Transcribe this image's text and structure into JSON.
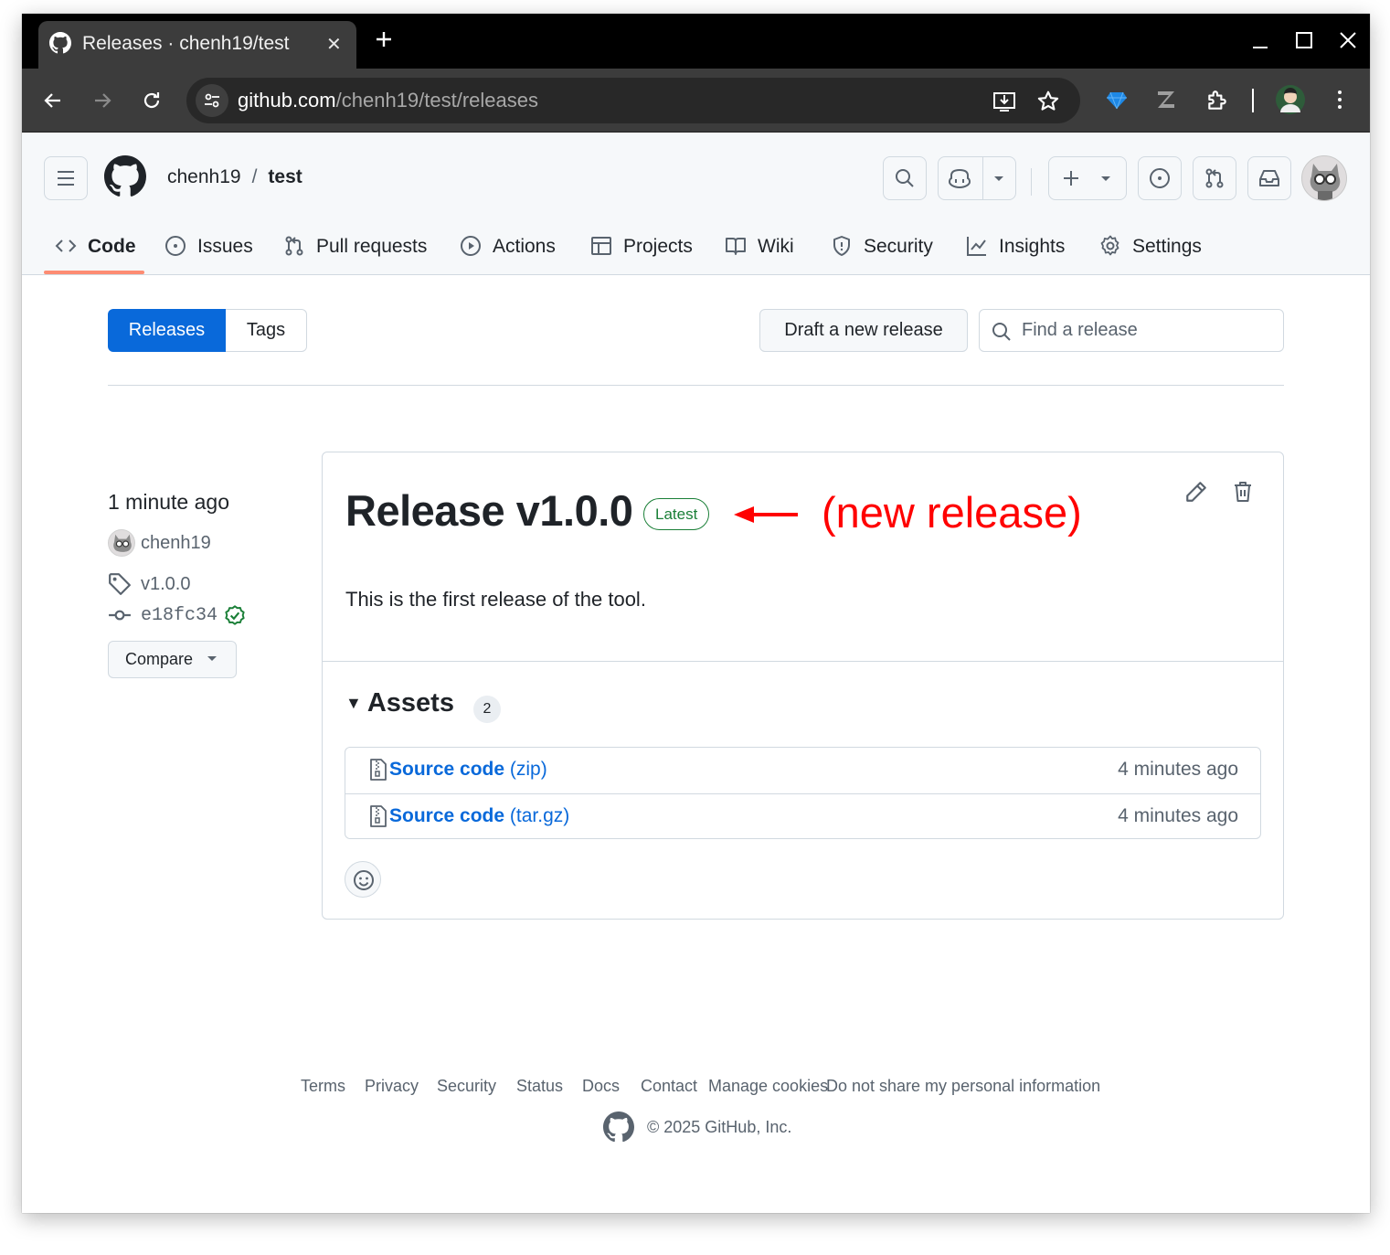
{
  "browser": {
    "tab_title": "Releases · chenh19/test",
    "url_host": "github.com",
    "url_path": "/chenh19/test/releases"
  },
  "header": {
    "owner": "chenh19",
    "separator": "/",
    "repo": "test"
  },
  "repo_nav": [
    {
      "label": "Code",
      "icon": "code-icon"
    },
    {
      "label": "Issues",
      "icon": "issue-icon"
    },
    {
      "label": "Pull requests",
      "icon": "pull-request-icon"
    },
    {
      "label": "Actions",
      "icon": "play-icon"
    },
    {
      "label": "Projects",
      "icon": "table-icon"
    },
    {
      "label": "Wiki",
      "icon": "book-icon"
    },
    {
      "label": "Security",
      "icon": "shield-icon"
    },
    {
      "label": "Insights",
      "icon": "graph-icon"
    },
    {
      "label": "Settings",
      "icon": "gear-icon"
    }
  ],
  "subnav": {
    "releases_label": "Releases",
    "tags_label": "Tags",
    "draft_label": "Draft a new release",
    "search_placeholder": "Find a release"
  },
  "release": {
    "published": "1 minute ago",
    "author": "chenh19",
    "tag": "v1.0.0",
    "commit": "e18fc34",
    "compare_label": "Compare",
    "title": "Release v1.0.0",
    "badge": "Latest",
    "annotation": "(new release)",
    "body": "This is the first release of the tool.",
    "assets_label": "Assets",
    "assets_count": "2",
    "assets": [
      {
        "name": "Source code",
        "ext": "(zip)",
        "time": "4 minutes ago"
      },
      {
        "name": "Source code",
        "ext": "(tar.gz)",
        "time": "4 minutes ago"
      }
    ]
  },
  "footer": {
    "links": [
      "Terms",
      "Privacy",
      "Security",
      "Status",
      "Docs",
      "Contact",
      "Manage cookies",
      "Do not share my personal information"
    ],
    "copyright": "© 2025 GitHub, Inc."
  },
  "colors": {
    "accent": "#0969da",
    "latest_green": "#1a7f37",
    "annotation_red": "#ff0000",
    "nav_underline": "#fd8c73"
  }
}
